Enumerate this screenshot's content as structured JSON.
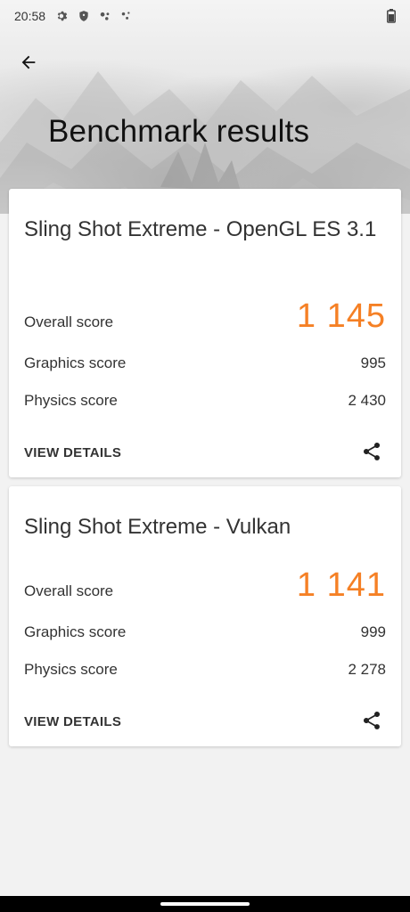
{
  "status_bar": {
    "time": "20:58",
    "icons": [
      "gear-icon",
      "shield-icon",
      "assistant-icon",
      "assistant-dots-icon"
    ],
    "battery_icon": "battery-icon"
  },
  "header": {
    "title": "Benchmark results",
    "back_icon": "arrow-back-icon"
  },
  "cards": [
    {
      "title": "Sling Shot Extreme - OpenGL ES 3.1",
      "overall_label": "Overall score",
      "overall_value": "1 145",
      "graphics_label": "Graphics score",
      "graphics_value": "995",
      "physics_label": "Physics score",
      "physics_value": "2 430",
      "details_label": "VIEW DETAILS"
    },
    {
      "title": "Sling Shot Extreme - Vulkan",
      "overall_label": "Overall score",
      "overall_value": "1 141",
      "graphics_label": "Graphics score",
      "graphics_value": "999",
      "physics_label": "Physics score",
      "physics_value": "2 278",
      "details_label": "VIEW DETAILS"
    }
  ],
  "colors": {
    "accent": "#f58025",
    "text": "#333333",
    "background": "#f2f2f2"
  }
}
